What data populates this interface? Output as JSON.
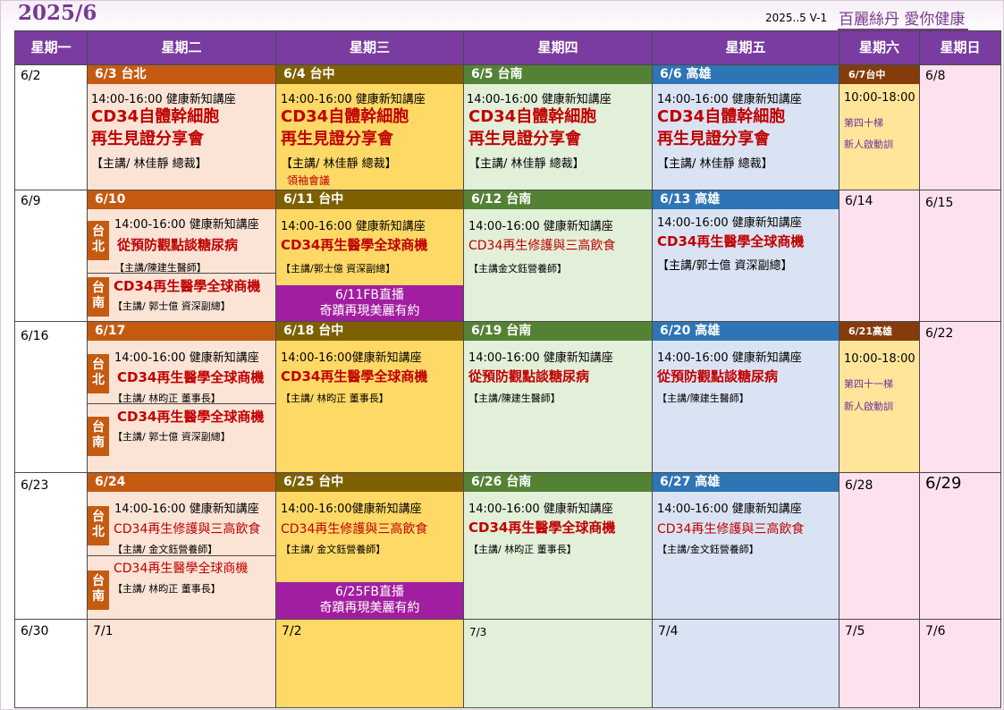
{
  "title": "2025/6",
  "version": "2025..5 V-1",
  "brand": "百麗絲丹  愛你健康",
  "weekdays": [
    "星期一",
    "星期二",
    "星期三",
    "星期四",
    "星期五",
    "星期六",
    "星期日"
  ],
  "colors": {
    "header": "#7a3ca0",
    "taipei": "#c55a11",
    "taichung": "#7f6000",
    "tainan": "#548235",
    "kaohsiung": "#2e75b6",
    "fb": "#a21ea0"
  },
  "w1": {
    "mon": "6/2",
    "tue": {
      "bar": "6/3 台北",
      "time": "14:00-16:00 健康新知講座",
      "t1": "CD34自體幹細胞",
      "t2": "再生見證分享會",
      "sp": "【主講/ 林佳靜 總裁】"
    },
    "wed": {
      "bar": "6/4 台中",
      "time": "14:00-16:00 健康新知講座",
      "t1": "CD34自體幹細胞",
      "t2": "再生見證分享會",
      "sp": "【主講/ 林佳靜 總裁】",
      "extra": "領袖會議"
    },
    "thu": {
      "bar": "6/5 台南",
      "time": " 14:00-16:00 健康新知講座",
      "t1": "CD34自體幹細胞",
      "t2": "再生見證分享會",
      "sp": "【主講/ 林佳靜 總裁】"
    },
    "fri": {
      "bar": "6/6 高雄",
      "time": "14:00-16:00 健康新知講座",
      "t1": "CD34自體幹細胞",
      "t2": "再生見證分享會",
      "sp": "【主講/ 林佳靜 總裁】"
    },
    "sat": {
      "bar": "6/7台中",
      "time": "10:00-18:00",
      "l1": "第四十梯",
      "l2": "新人啟動訓"
    },
    "sun": "6/8"
  },
  "w2": {
    "mon": "6/9",
    "tue": {
      "bar": "6/10",
      "b1": "台北",
      "time": "14:00-16:00 健康新知講座",
      "t1": "從預防觀點談糖尿病",
      "sp1": "【主講/陳建生醫師】",
      "b2": "台南",
      "t2": "CD34再生醫學全球商機",
      "sp2": "【主講/ 郭士億 資深副總】"
    },
    "wed": {
      "bar": "6/11 台中",
      "time": "14:00-16:00 健康新知講座",
      "t1": "CD34再生醫學全球商機",
      "sp": "【主講/郭士億 資深副總】",
      "fb1": "6/11FB直播",
      "fb2": "奇蹟再現美麗有約"
    },
    "thu": {
      "bar": "6/12 台南",
      "time": "14:00-16:00 健康新知講座",
      "t1": "CD34再生修護與三高飲食",
      "sp": "【主講金文鈺營養師】"
    },
    "fri": {
      "bar": "6/13 高雄",
      "time": "14:00-16:00 健康新知講座",
      "t1": "CD34再生醫學全球商機",
      "sp": "【主講/郭士億 資深副總】"
    },
    "sat": "6/14",
    "sun": "6/15"
  },
  "w3": {
    "mon": "6/16",
    "tue": {
      "bar": "6/17",
      "b1": "台北",
      "time": "14:00-16:00 健康新知講座",
      "t1": "CD34再生醫學全球商機",
      "sp1": "【主講/ 林昀正 董事長】",
      "b2": "台南",
      "t2": "CD34再生醫學全球商機",
      "sp2": "【主講/ 郭士億 資深副總】"
    },
    "wed": {
      "bar": "6/18 台中",
      "time": "14:00-16:00健康新知講座",
      "t1": "CD34再生醫學全球商機",
      "sp": "【主講/ 林昀正 董事長】"
    },
    "thu": {
      "bar": "6/19 台南",
      "time": "14:00-16:00 健康新知講座",
      "t1": "從預防觀點談糖尿病",
      "sp": "【主講/陳建生醫師】"
    },
    "fri": {
      "bar": "6/20 高雄",
      "time": "14:00-16:00 健康新知講座",
      "t1": "從預防觀點談糖尿病",
      "sp": "【主講/陳建生醫師】"
    },
    "sat": {
      "bar": "6/21高雄",
      "time": "10:00-18:00",
      "l1": "第四十一梯",
      "l2": "新人啟動訓"
    },
    "sun": "6/22"
  },
  "w4": {
    "mon": "6/23",
    "tue": {
      "bar": "6/24",
      "b1": "台北",
      "time": "14:00-16:00 健康新知講座",
      "t1": "CD34再生修護與三高飲食",
      "sp1": "【主講/ 金文鈺營養師】",
      "b2": "台南",
      "t2": "CD34再生醫學全球商機",
      "sp2": "【主講/ 林昀正 董事長】"
    },
    "wed": {
      "bar": "6/25 台中",
      "time": "14:00-16:00健康新知講座",
      "t1": "CD34再生修護與三高飲食",
      "sp": "【主講/ 金文鈺營養師】",
      "fb1": "6/25FB直播",
      "fb2": "奇蹟再現美麗有約"
    },
    "thu": {
      "bar": "6/26 台南",
      "time": "14:00-16:00 健康新知講座",
      "t1": "CD34再生醫學全球商機",
      "sp": "【主講/ 林昀正 董事長】"
    },
    "fri": {
      "bar": "6/27 高雄",
      "time": "14:00-16:00 健康新知講座",
      "t1": "CD34再生修護與三高飲食",
      "sp": "【主講/金文鈺營養師】"
    },
    "sat": "6/28",
    "sun": "6/29"
  },
  "w5": {
    "mon": "6/30",
    "tue": "7/1",
    "wed": "7/2",
    "thu": "7/3",
    "fri": "7/4",
    "sat": "7/5",
    "sun": "7/6"
  }
}
